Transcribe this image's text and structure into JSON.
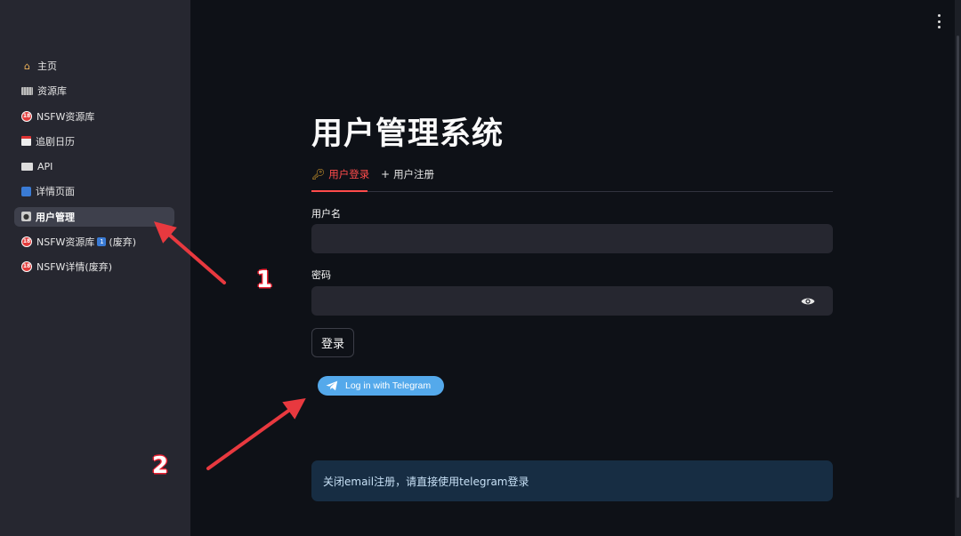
{
  "sidebar": {
    "items": [
      {
        "label": "主页",
        "icon": "house-icon"
      },
      {
        "label": "资源库",
        "icon": "keyboard-icon"
      },
      {
        "label": "NSFW资源库",
        "icon": "18-plus-icon"
      },
      {
        "label": "追剧日历",
        "icon": "calendar-icon"
      },
      {
        "label": "API",
        "icon": "envelope-icon"
      },
      {
        "label": "详情页面",
        "icon": "detail-icon"
      },
      {
        "label": "用户管理",
        "icon": "user-icon",
        "active": true
      },
      {
        "label": "NSFW资源库",
        "suffix_badge": "1",
        "suffix": "(废弃)",
        "icon": "18-plus-icon"
      },
      {
        "label": "NSFW详情(废弃)",
        "icon": "18-plus-icon"
      }
    ]
  },
  "main": {
    "title": "用户管理系统",
    "tabs": [
      {
        "label": "用户登录",
        "icon": "key-icon",
        "active": true
      },
      {
        "label": "用户注册",
        "icon": "plus-icon"
      }
    ],
    "username_label": "用户名",
    "username_value": "",
    "password_label": "密码",
    "password_value": "",
    "login_button": "登录",
    "telegram_button": "Log in with Telegram",
    "info_message": "关闭email注册，请直接使用telegram登录"
  },
  "annotations": {
    "marker_1": "1",
    "marker_2": "2",
    "arrow_color": "#e8393f"
  },
  "colors": {
    "background": "#0e1117",
    "sidebar": "#262730",
    "accent": "#ff4b4b",
    "telegram": "#54a9eb",
    "info_bg": "#172d43"
  }
}
